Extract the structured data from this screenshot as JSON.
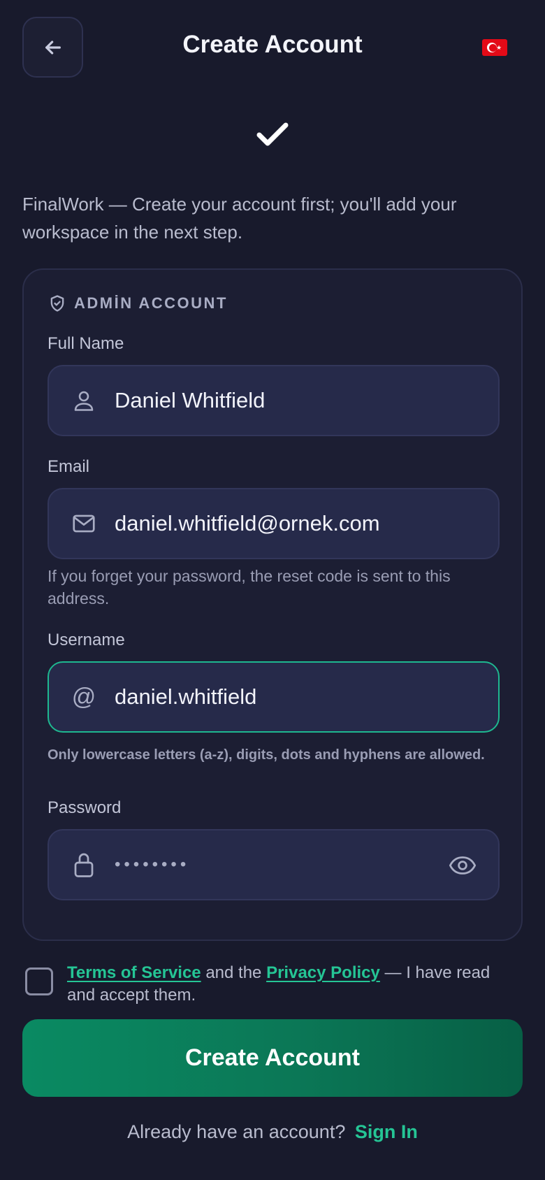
{
  "header": {
    "title": "Create Account",
    "back_icon": "arrow-left-icon",
    "language_flag": "turkey-flag-icon"
  },
  "intro": "FinalWork — Create your account first; you'll add your workspace in the next step.",
  "form": {
    "section_label": "ADMİN ACCOUNT",
    "full_name": {
      "label": "Full Name",
      "value": "Daniel Whitfield",
      "icon": "user-icon"
    },
    "email": {
      "label": "Email",
      "value": "daniel.whitfield@ornek.com",
      "icon": "mail-icon",
      "hint": "If you forget your password, the reset code is sent to this address."
    },
    "username": {
      "label": "Username",
      "prefix": "@",
      "value": "daniel.whitfield",
      "hint": "Only lowercase letters (a-z), digits, dots and hyphens are allowed."
    },
    "password": {
      "label": "Password",
      "masked_value": "••••••••",
      "icon": "lock-icon",
      "toggle_icon": "eye-icon"
    }
  },
  "terms": {
    "tos_link": "Terms of Service",
    "middle": " and the ",
    "privacy_link": "Privacy Policy",
    "tail": " — I have read and accept them.",
    "checked": false
  },
  "primary_button": "Create Account",
  "footer": {
    "question": "Already have an account?",
    "link": "Sign In"
  },
  "colors": {
    "background": "#181a2c",
    "accent": "#25c595",
    "button": "#0a8a62"
  }
}
